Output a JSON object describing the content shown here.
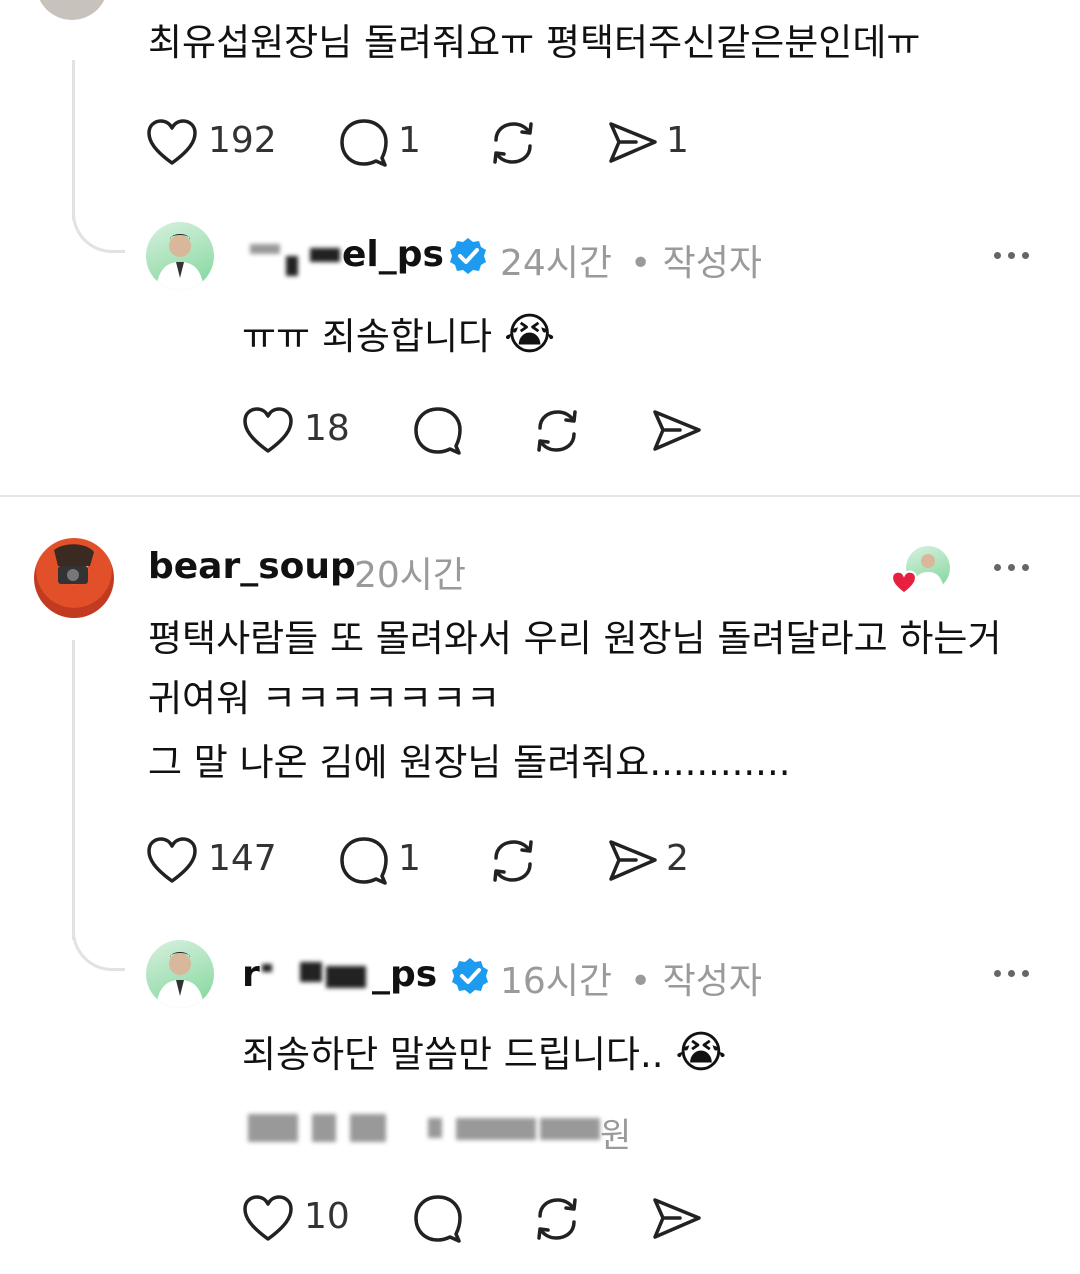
{
  "top_comment": {
    "text": "최유섭원장님 돌려줘요ㅠ 평택터주신같은분인데ㅠ",
    "likes": "192",
    "replies": "1",
    "shares": "1"
  },
  "reply1": {
    "username": "el_ps",
    "time": "24시간",
    "author_label": "• 작성자",
    "text": "ㅠㅠ 죄송합니다",
    "emoji": "😭",
    "likes": "18"
  },
  "comment2": {
    "username": "bear_soup",
    "time": "20시간",
    "lines": [
      "평택사람들 또 몰려와서 우리 원장님 돌려달라고 하는거",
      "귀여워 ㅋㅋㅋㅋㅋㅋㅋ",
      "그 말 나온 김에 원장님 돌려줘요............"
    ],
    "likes": "147",
    "replies": "1",
    "shares": "2"
  },
  "reply2": {
    "username_prefix": "r",
    "username_suffix": "_ps",
    "time": "16시간",
    "author_label": "• 작성자",
    "text": "죄송하단 말씀만 드립니다..",
    "emoji": "😭",
    "translated_fragment": "원",
    "likes": "10"
  },
  "icons": {
    "like": "heart-icon",
    "reply": "speech-bubble-icon",
    "repost": "repost-icon",
    "share": "send-icon",
    "more": "more-dots-icon",
    "verified": "verified-badge-icon"
  },
  "colors": {
    "verified": "#1d9bf0",
    "heart": "#e8203f",
    "meta": "#9a9a9a"
  }
}
